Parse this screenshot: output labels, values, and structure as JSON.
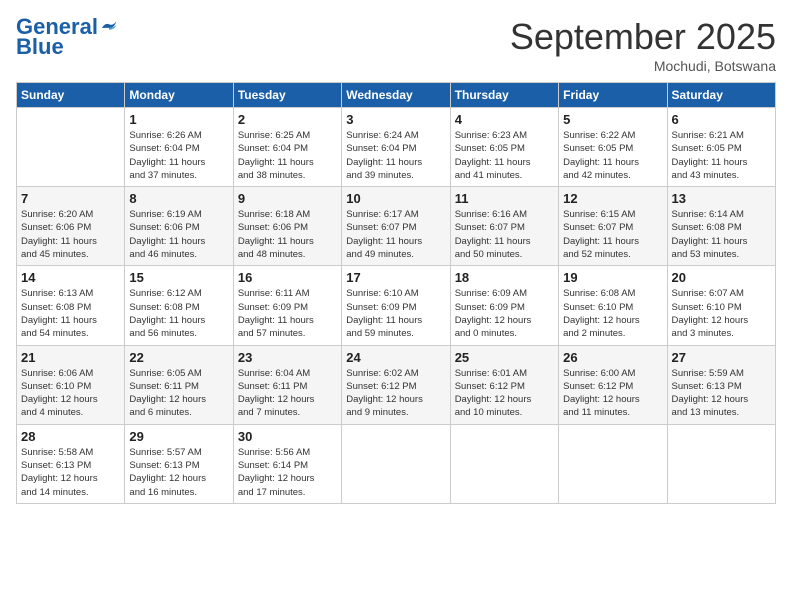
{
  "logo": {
    "general": "General",
    "blue": "Blue"
  },
  "title": "September 2025",
  "location": "Mochudi, Botswana",
  "days": [
    "Sunday",
    "Monday",
    "Tuesday",
    "Wednesday",
    "Thursday",
    "Friday",
    "Saturday"
  ],
  "weeks": [
    [
      {
        "num": "",
        "info": ""
      },
      {
        "num": "1",
        "info": "Sunrise: 6:26 AM\nSunset: 6:04 PM\nDaylight: 11 hours\nand 37 minutes."
      },
      {
        "num": "2",
        "info": "Sunrise: 6:25 AM\nSunset: 6:04 PM\nDaylight: 11 hours\nand 38 minutes."
      },
      {
        "num": "3",
        "info": "Sunrise: 6:24 AM\nSunset: 6:04 PM\nDaylight: 11 hours\nand 39 minutes."
      },
      {
        "num": "4",
        "info": "Sunrise: 6:23 AM\nSunset: 6:05 PM\nDaylight: 11 hours\nand 41 minutes."
      },
      {
        "num": "5",
        "info": "Sunrise: 6:22 AM\nSunset: 6:05 PM\nDaylight: 11 hours\nand 42 minutes."
      },
      {
        "num": "6",
        "info": "Sunrise: 6:21 AM\nSunset: 6:05 PM\nDaylight: 11 hours\nand 43 minutes."
      }
    ],
    [
      {
        "num": "7",
        "info": "Sunrise: 6:20 AM\nSunset: 6:06 PM\nDaylight: 11 hours\nand 45 minutes."
      },
      {
        "num": "8",
        "info": "Sunrise: 6:19 AM\nSunset: 6:06 PM\nDaylight: 11 hours\nand 46 minutes."
      },
      {
        "num": "9",
        "info": "Sunrise: 6:18 AM\nSunset: 6:06 PM\nDaylight: 11 hours\nand 48 minutes."
      },
      {
        "num": "10",
        "info": "Sunrise: 6:17 AM\nSunset: 6:07 PM\nDaylight: 11 hours\nand 49 minutes."
      },
      {
        "num": "11",
        "info": "Sunrise: 6:16 AM\nSunset: 6:07 PM\nDaylight: 11 hours\nand 50 minutes."
      },
      {
        "num": "12",
        "info": "Sunrise: 6:15 AM\nSunset: 6:07 PM\nDaylight: 11 hours\nand 52 minutes."
      },
      {
        "num": "13",
        "info": "Sunrise: 6:14 AM\nSunset: 6:08 PM\nDaylight: 11 hours\nand 53 minutes."
      }
    ],
    [
      {
        "num": "14",
        "info": "Sunrise: 6:13 AM\nSunset: 6:08 PM\nDaylight: 11 hours\nand 54 minutes."
      },
      {
        "num": "15",
        "info": "Sunrise: 6:12 AM\nSunset: 6:08 PM\nDaylight: 11 hours\nand 56 minutes."
      },
      {
        "num": "16",
        "info": "Sunrise: 6:11 AM\nSunset: 6:09 PM\nDaylight: 11 hours\nand 57 minutes."
      },
      {
        "num": "17",
        "info": "Sunrise: 6:10 AM\nSunset: 6:09 PM\nDaylight: 11 hours\nand 59 minutes."
      },
      {
        "num": "18",
        "info": "Sunrise: 6:09 AM\nSunset: 6:09 PM\nDaylight: 12 hours\nand 0 minutes."
      },
      {
        "num": "19",
        "info": "Sunrise: 6:08 AM\nSunset: 6:10 PM\nDaylight: 12 hours\nand 2 minutes."
      },
      {
        "num": "20",
        "info": "Sunrise: 6:07 AM\nSunset: 6:10 PM\nDaylight: 12 hours\nand 3 minutes."
      }
    ],
    [
      {
        "num": "21",
        "info": "Sunrise: 6:06 AM\nSunset: 6:10 PM\nDaylight: 12 hours\nand 4 minutes."
      },
      {
        "num": "22",
        "info": "Sunrise: 6:05 AM\nSunset: 6:11 PM\nDaylight: 12 hours\nand 6 minutes."
      },
      {
        "num": "23",
        "info": "Sunrise: 6:04 AM\nSunset: 6:11 PM\nDaylight: 12 hours\nand 7 minutes."
      },
      {
        "num": "24",
        "info": "Sunrise: 6:02 AM\nSunset: 6:12 PM\nDaylight: 12 hours\nand 9 minutes."
      },
      {
        "num": "25",
        "info": "Sunrise: 6:01 AM\nSunset: 6:12 PM\nDaylight: 12 hours\nand 10 minutes."
      },
      {
        "num": "26",
        "info": "Sunrise: 6:00 AM\nSunset: 6:12 PM\nDaylight: 12 hours\nand 11 minutes."
      },
      {
        "num": "27",
        "info": "Sunrise: 5:59 AM\nSunset: 6:13 PM\nDaylight: 12 hours\nand 13 minutes."
      }
    ],
    [
      {
        "num": "28",
        "info": "Sunrise: 5:58 AM\nSunset: 6:13 PM\nDaylight: 12 hours\nand 14 minutes."
      },
      {
        "num": "29",
        "info": "Sunrise: 5:57 AM\nSunset: 6:13 PM\nDaylight: 12 hours\nand 16 minutes."
      },
      {
        "num": "30",
        "info": "Sunrise: 5:56 AM\nSunset: 6:14 PM\nDaylight: 12 hours\nand 17 minutes."
      },
      {
        "num": "",
        "info": ""
      },
      {
        "num": "",
        "info": ""
      },
      {
        "num": "",
        "info": ""
      },
      {
        "num": "",
        "info": ""
      }
    ]
  ]
}
